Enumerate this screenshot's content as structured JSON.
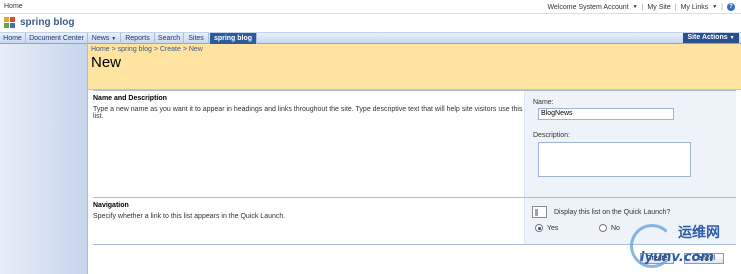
{
  "topbar": {
    "home": "Home",
    "welcome": "Welcome System Account",
    "my_site": "My Site",
    "my_links": "My Links"
  },
  "site": {
    "title": "spring blog"
  },
  "nav": {
    "tabs": [
      {
        "label": "Home"
      },
      {
        "label": "Document Center"
      },
      {
        "label": "News"
      },
      {
        "label": "Reports"
      },
      {
        "label": "Search"
      },
      {
        "label": "Sites"
      },
      {
        "label": "spring blog"
      }
    ],
    "site_actions": "Site Actions"
  },
  "header": {
    "breadcrumb": "Home > spring blog > Create > New",
    "page_title": "New"
  },
  "name_section": {
    "title": "Name and Description",
    "description": "Type a new name as you want it to appear in headings and links throughout the site. Type descriptive text that will help site visitors use this list.",
    "name_label": "Name:",
    "name_value": "BlogNews",
    "description_label": "Description:",
    "description_value": ""
  },
  "navigation_section": {
    "title": "Navigation",
    "description": "Specify whether a link to this list appears in the Quick Launch.",
    "question": "Display this list on the Quick Launch?",
    "yes_label": "Yes",
    "no_label": "No",
    "selected": "Yes"
  },
  "buttons": {
    "create": "Create",
    "cancel": "Cancel"
  },
  "watermark": {
    "text1": "运维网",
    "text2": "iyunv.com"
  }
}
